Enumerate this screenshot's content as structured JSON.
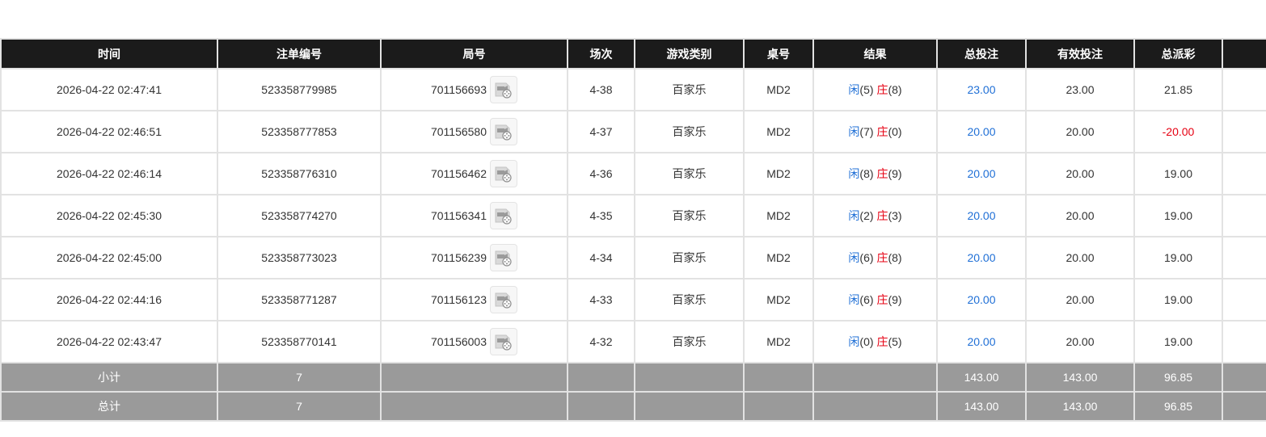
{
  "header": {
    "columns": [
      "时间",
      "注单编号",
      "局号",
      "场次",
      "游戏类别",
      "桌号",
      "结果",
      "总投注",
      "有效投注",
      "总派彩",
      ""
    ]
  },
  "icons": {
    "video_replay": "video-replay-icon"
  },
  "colors": {
    "header_bg": "#1b1b1b",
    "footer_bg": "#9a9a9a",
    "link_blue": "#1f6fd6",
    "banker_red": "#e60012"
  },
  "rows": [
    {
      "time": "2026-04-22 02:47:41",
      "bet_id": "523358779985",
      "round_id": "701156693",
      "session": "4-38",
      "game": "百家乐",
      "table": "MD2",
      "player_label": "闲",
      "player_score": "(5)",
      "banker_label": "庄",
      "banker_score": "(8)",
      "total_bet": "23.00",
      "valid_bet": "23.00",
      "payout": "21.85"
    },
    {
      "time": "2026-04-22 02:46:51",
      "bet_id": "523358777853",
      "round_id": "701156580",
      "session": "4-37",
      "game": "百家乐",
      "table": "MD2",
      "player_label": "闲",
      "player_score": "(7)",
      "banker_label": "庄",
      "banker_score": "(0)",
      "total_bet": "20.00",
      "valid_bet": "20.00",
      "payout": "-20.00"
    },
    {
      "time": "2026-04-22 02:46:14",
      "bet_id": "523358776310",
      "round_id": "701156462",
      "session": "4-36",
      "game": "百家乐",
      "table": "MD2",
      "player_label": "闲",
      "player_score": "(8)",
      "banker_label": "庄",
      "banker_score": "(9)",
      "total_bet": "20.00",
      "valid_bet": "20.00",
      "payout": "19.00"
    },
    {
      "time": "2026-04-22 02:45:30",
      "bet_id": "523358774270",
      "round_id": "701156341",
      "session": "4-35",
      "game": "百家乐",
      "table": "MD2",
      "player_label": "闲",
      "player_score": "(2)",
      "banker_label": "庄",
      "banker_score": "(3)",
      "total_bet": "20.00",
      "valid_bet": "20.00",
      "payout": "19.00"
    },
    {
      "time": "2026-04-22 02:45:00",
      "bet_id": "523358773023",
      "round_id": "701156239",
      "session": "4-34",
      "game": "百家乐",
      "table": "MD2",
      "player_label": "闲",
      "player_score": "(6)",
      "banker_label": "庄",
      "banker_score": "(8)",
      "total_bet": "20.00",
      "valid_bet": "20.00",
      "payout": "19.00"
    },
    {
      "time": "2026-04-22 02:44:16",
      "bet_id": "523358771287",
      "round_id": "701156123",
      "session": "4-33",
      "game": "百家乐",
      "table": "MD2",
      "player_label": "闲",
      "player_score": "(6)",
      "banker_label": "庄",
      "banker_score": "(9)",
      "total_bet": "20.00",
      "valid_bet": "20.00",
      "payout": "19.00"
    },
    {
      "time": "2026-04-22 02:43:47",
      "bet_id": "523358770141",
      "round_id": "701156003",
      "session": "4-32",
      "game": "百家乐",
      "table": "MD2",
      "player_label": "闲",
      "player_score": "(0)",
      "banker_label": "庄",
      "banker_score": "(5)",
      "total_bet": "20.00",
      "valid_bet": "20.00",
      "payout": "19.00"
    }
  ],
  "subtotal": {
    "label": "小计",
    "count": "7",
    "total_bet": "143.00",
    "valid_bet": "143.00",
    "payout": "96.85"
  },
  "grand_total": {
    "label": "总计",
    "count": "7",
    "total_bet": "143.00",
    "valid_bet": "143.00",
    "payout": "96.85"
  }
}
